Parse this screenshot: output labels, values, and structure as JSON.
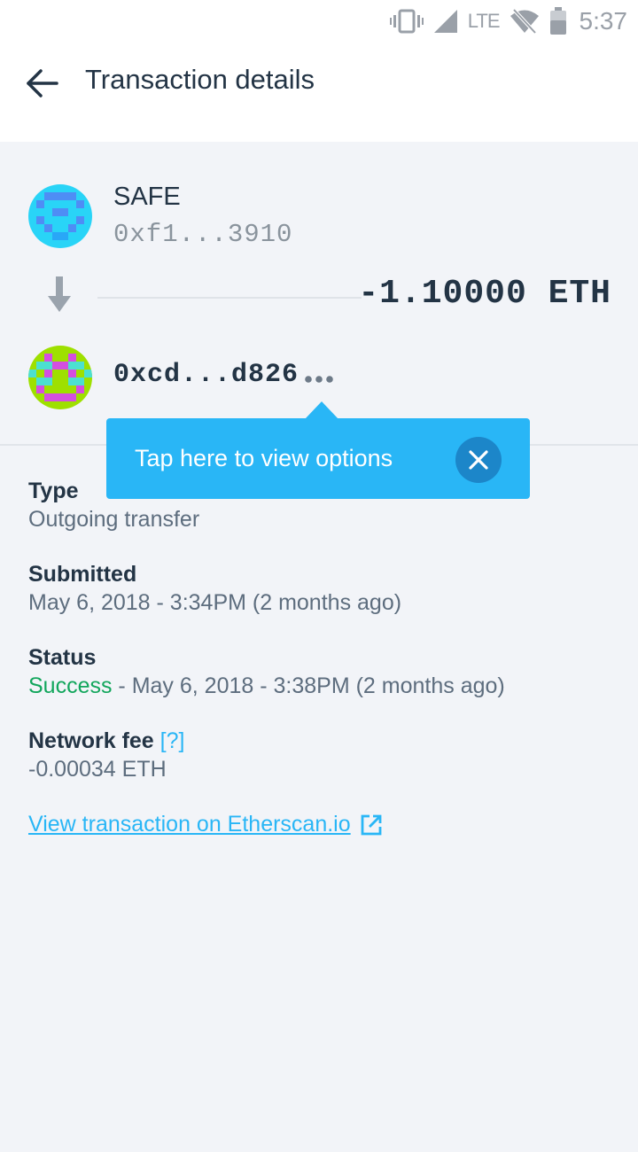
{
  "status_bar": {
    "network": "LTE",
    "time": "5:37"
  },
  "header": {
    "title": "Transaction details"
  },
  "transfer": {
    "sender_name": "SAFE",
    "sender_address": "0xf1...3910",
    "amount": "-1.10000 ETH",
    "recipient_address": "0xcd...d826"
  },
  "tooltip": {
    "text": "Tap here to view options"
  },
  "details": {
    "type_label": "Type",
    "type_value": "Outgoing transfer",
    "submitted_label": "Submitted",
    "submitted_value": "May 6, 2018 - 3:34PM (2 months ago)",
    "status_label": "Status",
    "status_state": "Success",
    "status_value": " - May 6, 2018 - 3:38PM (2 months ago)",
    "fee_label": "Network fee",
    "fee_help": "[?]",
    "fee_value": "-0.00034 ETH",
    "etherscan_link": "View transaction on Etherscan.io"
  },
  "colors": {
    "accent": "#29b6f6",
    "success": "#12a65c",
    "text_primary": "#233445",
    "text_secondary": "#5d6d7e"
  }
}
